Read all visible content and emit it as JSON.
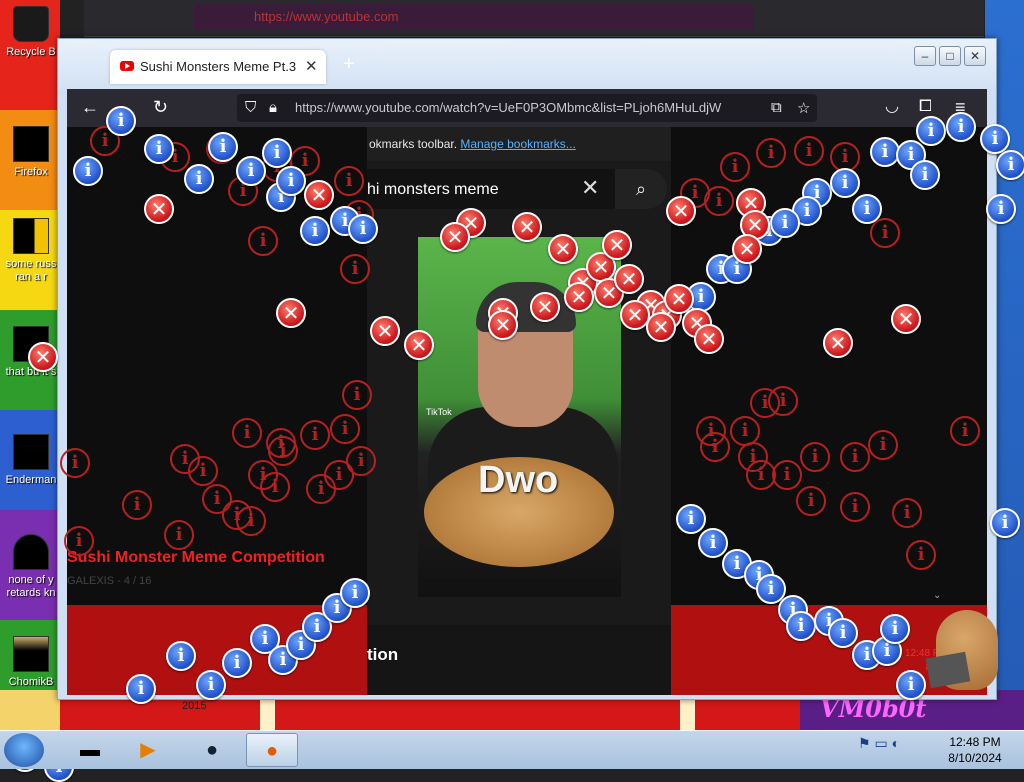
{
  "desktop": {
    "icons": [
      {
        "label": "Recycle B"
      },
      {
        "label": "Firefox"
      },
      {
        "label": "some russ",
        "label2": "ran a r"
      },
      {
        "label": "that bu it s"
      },
      {
        "label": "Enderman"
      },
      {
        "label": "none of y",
        "label2": "retards kn"
      },
      {
        "label": "ChomikB"
      }
    ],
    "wallpaper_text": "VM0b0t",
    "year": "2015"
  },
  "background_browser": {
    "url": "https://www.youtube.com"
  },
  "window": {
    "tab_title": "Sushi Monsters Meme Pt.3 - Yo",
    "tab_close": "✕",
    "new_tab": "+",
    "controls": {
      "minimize": "–",
      "maximize": "□",
      "close": "✕"
    },
    "url": "https://www.youtube.com/watch?v=UeF0P3OMbmc&list=PLjoh6MHuLdjW"
  },
  "page": {
    "bookmarks_bar_text": "okmarks toolbar.",
    "bookmarks_link": "Manage bookmarks...",
    "search_query": "hi monsters meme",
    "video_overlay_text": "Dwo",
    "video_watermark": "TikTok",
    "playlist_title": "Sushi Monster Meme Competition",
    "playlist_sub": "GALEXIS - 4 / 16",
    "below_video_text": "tion",
    "ghost_clock": "12:48 PM",
    "ghost_date": "8/10/"
  },
  "taskbar": {
    "time": "12:48 PM",
    "date": "8/10/2024"
  },
  "colors": {
    "info_blue": "#2050c8",
    "error_red": "#c8141a",
    "youtube_red": "#ee0000"
  }
}
